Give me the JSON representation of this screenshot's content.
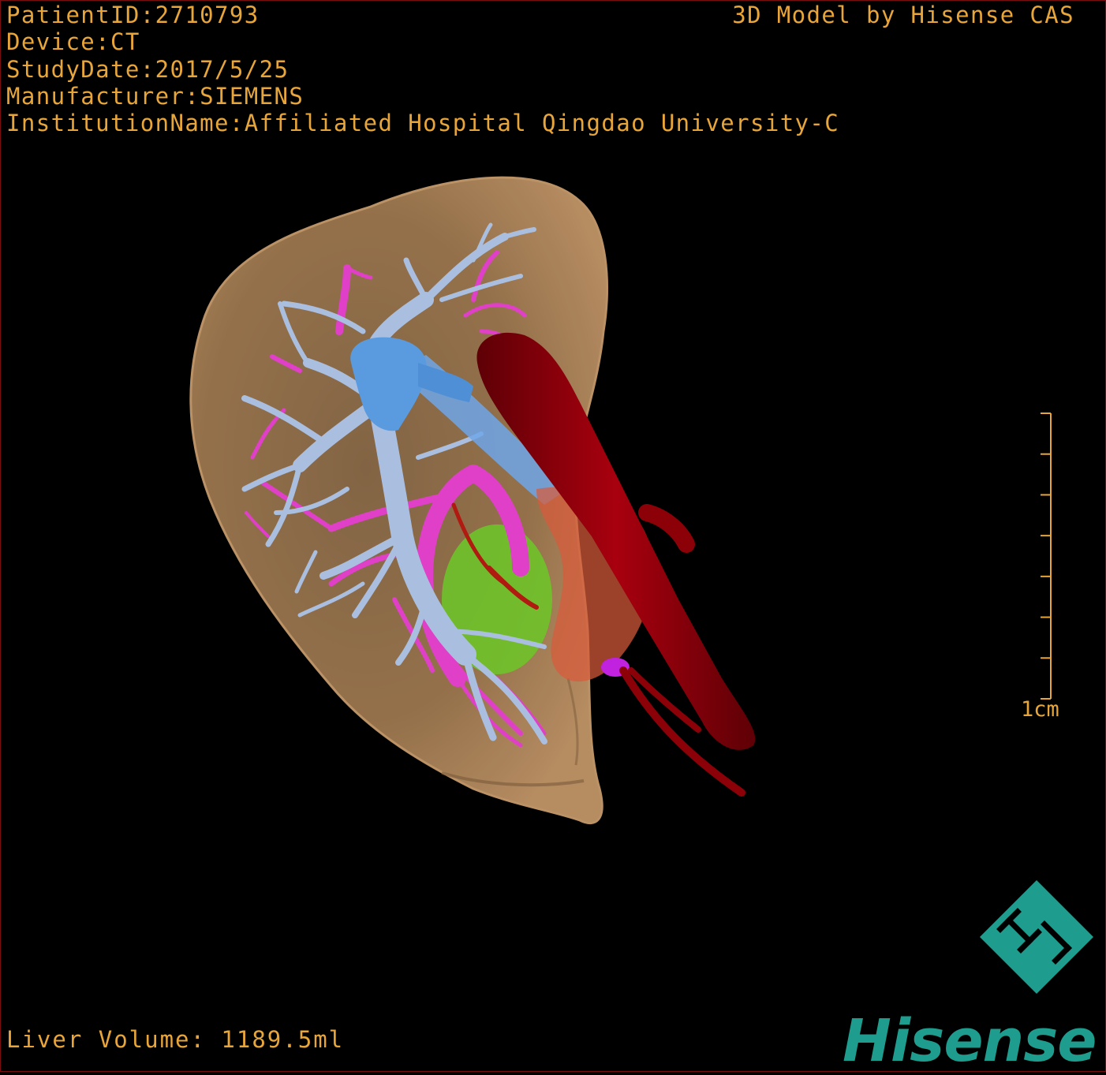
{
  "study_info": {
    "patient_id": "PatientID:2710793",
    "device": "Device:CT",
    "study_date": "StudyDate:2017/5/25",
    "manufacturer": "Manufacturer:SIEMENS",
    "institution": "InstitutionName:Affiliated Hospital Qingdao University-C"
  },
  "credit": "3D Model by Hisense CAS",
  "liver_volume": "Liver Volume: 1189.5ml",
  "scale_bar": {
    "label": "1cm",
    "tick_count": 8
  },
  "brand": {
    "name": "Hisense",
    "color": "#1e9c8e"
  },
  "colors": {
    "text": "#e8a63a",
    "liver": "#b48a5e",
    "portal_vein": "#aabfdf",
    "hepatic_vein_trunk": "#5a9be0",
    "hepatic_artery": "#e040c8",
    "aorta": "#8c0008",
    "tumor": "#6cc828",
    "kidney": "#d85a3a"
  }
}
